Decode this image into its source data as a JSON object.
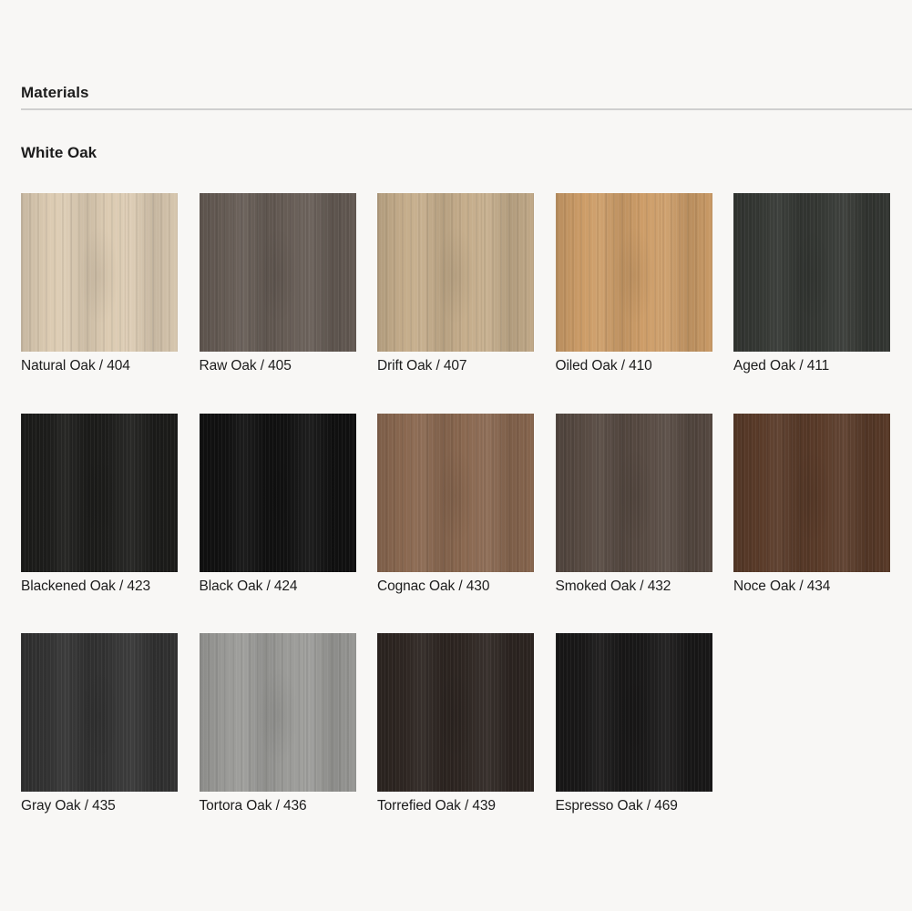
{
  "section": {
    "title": "Materials"
  },
  "subsection": {
    "title": "White Oak"
  },
  "swatches": [
    {
      "label": "Natural Oak / 404",
      "color": "#dccbb2"
    },
    {
      "label": "Raw Oak / 405",
      "color": "#665c55"
    },
    {
      "label": "Drift Oak / 407",
      "color": "#c5ad8b"
    },
    {
      "label": "Oiled Oak / 410",
      "color": "#cd9d68"
    },
    {
      "label": "Aged Oak / 411",
      "color": "#353834"
    },
    {
      "label": "Blackened Oak / 423",
      "color": "#1d1d1b"
    },
    {
      "label": "Black Oak / 424",
      "color": "#111111"
    },
    {
      "label": "Cognac Oak / 430",
      "color": "#8a6850"
    },
    {
      "label": "Smoked Oak / 432",
      "color": "#574a42"
    },
    {
      "label": "Noce Oak / 434",
      "color": "#5a3b29"
    },
    {
      "label": "Gray Oak / 435",
      "color": "#333333"
    },
    {
      "label": "Tortora Oak / 436",
      "color": "#9b9b98"
    },
    {
      "label": "Torrefied Oak / 439",
      "color": "#2e2622"
    },
    {
      "label": "Espresso Oak / 469",
      "color": "#191818"
    }
  ]
}
